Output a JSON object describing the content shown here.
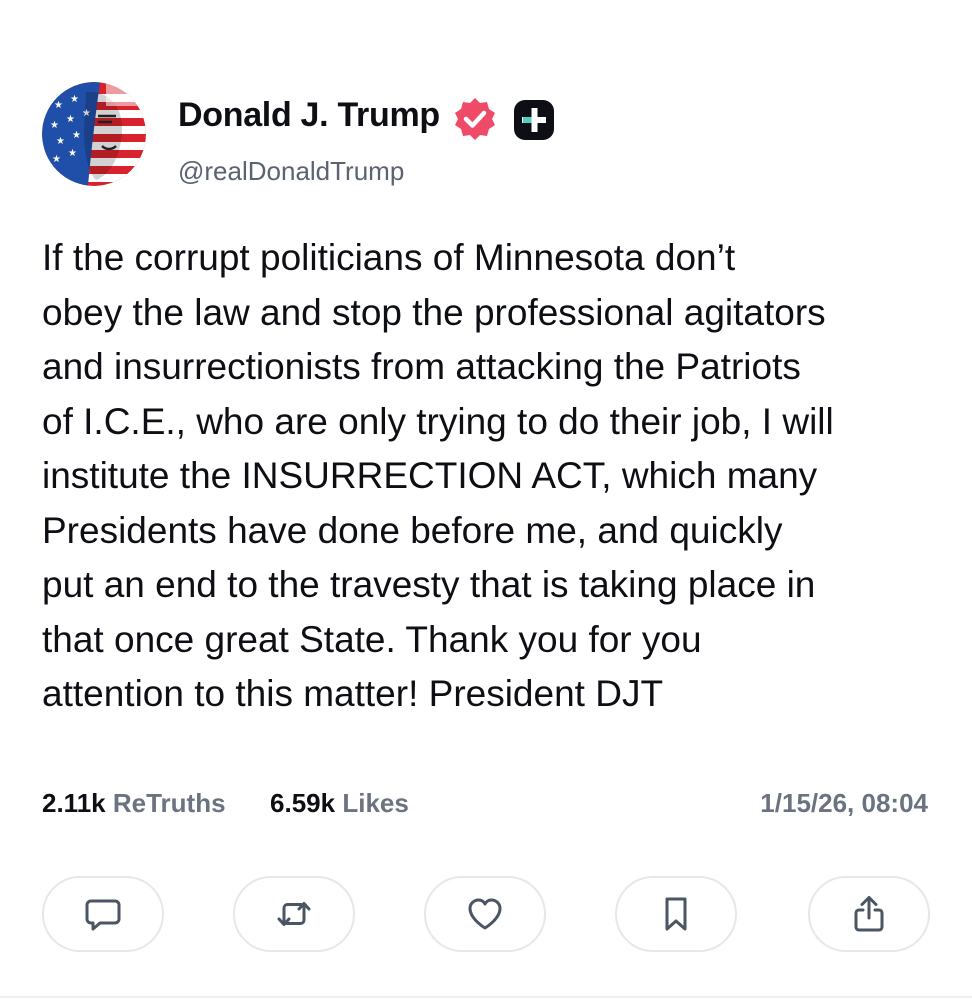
{
  "author": {
    "name": "Donald J. Trump",
    "handle": "@realDonaldTrump",
    "avatar_icon": "flag-portrait-avatar",
    "verified_icon": "verified-badge-icon",
    "verified_color": "#ef4a68",
    "plus_icon": "plus-badge-icon"
  },
  "post": {
    "text": "If the corrupt politicians of Minnesota don’t\nobey the law and stop the professional agitators\nand insurrectionists from attacking the Patriots\nof I.C.E., who are only trying to do their job, I will\ninstitute the INSURRECTION ACT, which many\nPresidents have done before me, and quickly\nput an end to the travesty that is taking place in\nthat once great State. Thank you for you\nattention to this matter! President DJT"
  },
  "stats": {
    "retruths_count": "2.11k",
    "retruths_label": "ReTruths",
    "likes_count": "6.59k",
    "likes_label": "Likes",
    "timestamp": "1/15/26, 08:04"
  },
  "actions": [
    {
      "name": "reply",
      "icon": "comment-icon"
    },
    {
      "name": "retruth",
      "icon": "retruth-icon"
    },
    {
      "name": "like",
      "icon": "heart-icon"
    },
    {
      "name": "bookmark",
      "icon": "bookmark-icon"
    },
    {
      "name": "share",
      "icon": "share-icon"
    }
  ],
  "colors": {
    "text": "#0d0f14",
    "muted": "#6b7280",
    "button_border": "#e5e7eb",
    "icon": "#4b5563"
  }
}
